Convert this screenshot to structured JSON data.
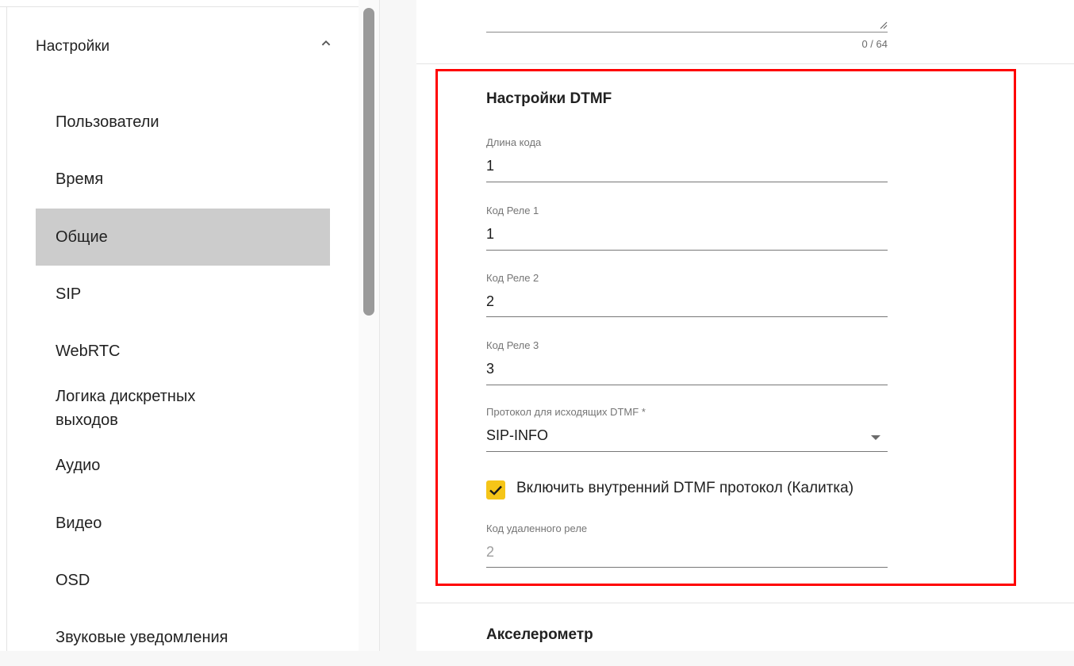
{
  "sidebar": {
    "section_title": "Настройки",
    "items": [
      {
        "label": "Пользователи"
      },
      {
        "label": "Время"
      },
      {
        "label": "Общие",
        "active": true
      },
      {
        "label": "SIP"
      },
      {
        "label": "WebRTC"
      },
      {
        "label": "Логика дискретных выходов"
      },
      {
        "label": "Аудио"
      },
      {
        "label": "Видео"
      },
      {
        "label": "OSD"
      },
      {
        "label": "Звуковые уведомления"
      }
    ]
  },
  "content": {
    "top_textarea": {
      "counter": "0 / 64"
    },
    "dtmf": {
      "title": "Настройки DTMF",
      "code_length": {
        "label": "Длина кода",
        "value": "1"
      },
      "relay1": {
        "label": "Код Реле 1",
        "value": "1"
      },
      "relay2": {
        "label": "Код Реле 2",
        "value": "2"
      },
      "relay3": {
        "label": "Код Реле 3",
        "value": "3"
      },
      "protocol": {
        "label": "Протокол для исходящих DTMF *",
        "value": "SIP-INFO"
      },
      "internal_protocol": {
        "label": "Включить внутренний DTMF протокол (Калитка)",
        "checked": true
      },
      "remote_relay": {
        "label": "Код удаленного реле",
        "value": "2"
      }
    },
    "accelerometer": {
      "title": "Акселерометр"
    }
  },
  "colors": {
    "accent_checkbox": "#f5c518",
    "highlight_border": "#ff0000",
    "active_nav_bg": "#cccccc"
  }
}
